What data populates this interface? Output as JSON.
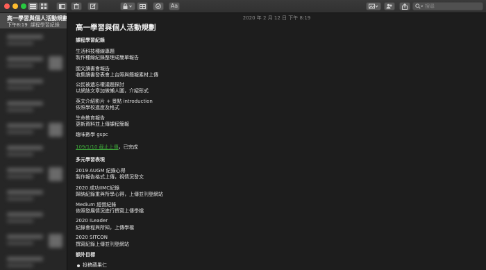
{
  "toolbar": {
    "format_label": "Aa",
    "search_placeholder": "搜尋"
  },
  "sidebar": {
    "selected_note": {
      "title": "高一學習與個人活動規劃",
      "time": "下午8:19",
      "preview": "課程學習紀錄"
    }
  },
  "note": {
    "date": "2020 年 2 月 12 日 下午 8:19",
    "title": "高一學習與個人活動規劃",
    "lines": [
      "課程學習紀錄",
      "生活科技種線專題",
      "製作種線紀錄整理成簡單報告",
      "國文讀書會報告",
      "收集讀書發表會上台照與簡報素材上傳",
      "公民被遺忘權議題探討",
      "以網誌文章加做懶人圖，介紹形式",
      "英文介紹影片 + 景點 introduction",
      "依照學校進度及格式",
      "生命教育報告",
      "更新資料並上傳課程簡報",
      "趣味數學 gspc",
      "109/1/10 截止上傳",
      "，已完成",
      "多元學習表現",
      "2019 AUGM 紀錄心得",
      "製作報告格式上傳，視情況發文",
      "2020 成功IIMC紀錄",
      "歸納紀錄重與所學心得，上傳並刊登網站",
      "Medium 經營紀錄",
      "依照發展情況進行撰寫上傳學檔",
      "2020 ILeader",
      "紀錄會程與所知，上傳學檔",
      "2020 SITCON",
      "撰寫紀錄上傳並刊登網站",
      "額外目標",
      "投稿蘋果仁"
    ]
  }
}
